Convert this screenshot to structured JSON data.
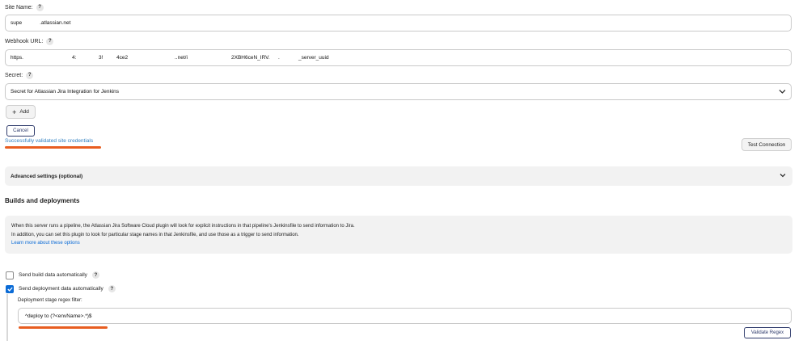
{
  "site_name": {
    "label": "Site Name:",
    "help": "?",
    "value_prefix": "supe",
    "value_suffix": ".atlassian.net"
  },
  "webhook_url": {
    "label": "Webhook URL:",
    "help": "?",
    "segments": [
      "https.",
      "4:",
      "3!",
      "4ce2",
      "..net/i",
      "2XBH6ceN_IRV.",
      ".",
      "_server_uuid"
    ]
  },
  "secret": {
    "label": "Secret:",
    "help": "?",
    "selected": "Secret for Atlassian Jira Integration for Jenkins"
  },
  "buttons": {
    "add": "Add",
    "add_icon": "+",
    "cancel": "Cancel",
    "test_connection": "Test Connection",
    "validate_regex": "Validate Regex"
  },
  "status": {
    "message": "Successfully validated site credentials"
  },
  "advanced": {
    "label": "Advanced settings (optional)"
  },
  "builds": {
    "heading": "Builds and deployments",
    "info_line1": "When this server runs a pipeline, the Atlassian Jira Software Cloud plugin will look for explicit instructions in that pipeline's Jenkinsfile to send information to Jira.",
    "info_line2": "In addition, you can set this plugin to look for particular stage names in that Jenkinsfile, and use those as a trigger to send information.",
    "learn_more": "Learn more about these options"
  },
  "options": {
    "build_data": {
      "label": "Send build data automatically",
      "help": "?",
      "checked": false
    },
    "deployment_data": {
      "label": "Send deployment data automatically",
      "help": "?",
      "checked": true
    }
  },
  "deployment_regex": {
    "label": "Deployment stage regex filter:",
    "value": "^deploy to (?<envName>.*)$"
  },
  "colors": {
    "accent": "#0b6bd6",
    "success": "#2b7a3d",
    "highlight": "#e85d20"
  }
}
